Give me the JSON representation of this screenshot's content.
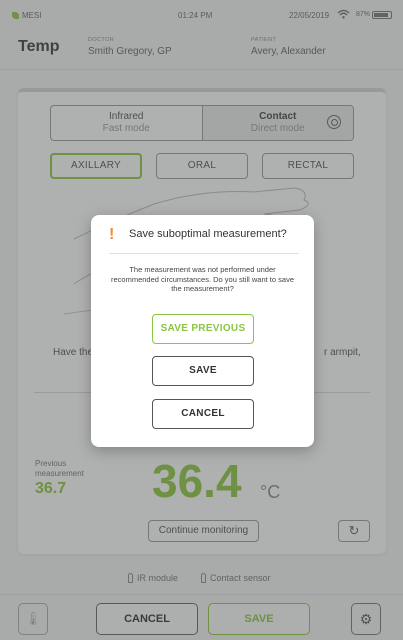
{
  "status_bar": {
    "brand": "MESI",
    "time": "01:24 PM",
    "date": "22/05/2019",
    "battery": "87%"
  },
  "header": {
    "title": "Temp",
    "doctor_caption": "DOCTOR",
    "doctor_name": "Smith Gregory, GP",
    "patient_caption": "PATIENT",
    "patient_name": "Avery, Alexander"
  },
  "modes": [
    {
      "line1": "Infrared",
      "line2": "Fast mode",
      "active": false
    },
    {
      "line1": "Contact",
      "line2": "Direct mode",
      "active": true
    }
  ],
  "sites": [
    {
      "label": "AXILLARY",
      "selected": true
    },
    {
      "label": "ORAL",
      "selected": false
    },
    {
      "label": "RECTAL",
      "selected": false
    }
  ],
  "instruction_left": "Have the",
  "instruction_right": "r armpit,",
  "previous": {
    "label": "Previous measurement",
    "value": "36.7"
  },
  "reading": {
    "value": "36.4",
    "unit": "°C"
  },
  "continue_label": "Continue monitoring",
  "sensors": {
    "ir": "IR module",
    "contact": "Contact sensor"
  },
  "bottom": {
    "cancel": "CANCEL",
    "save": "SAVE"
  },
  "dialog": {
    "icon": "!",
    "title": "Save suboptimal measurement?",
    "body": "The measurement was not performed under recommended circumstances. Do you still want to save the measurement?",
    "save_previous": "SAVE PREVIOUS",
    "save": "SAVE",
    "cancel": "CANCEL"
  },
  "colors": {
    "accent": "#8cc640",
    "warning": "#f08c2a"
  }
}
